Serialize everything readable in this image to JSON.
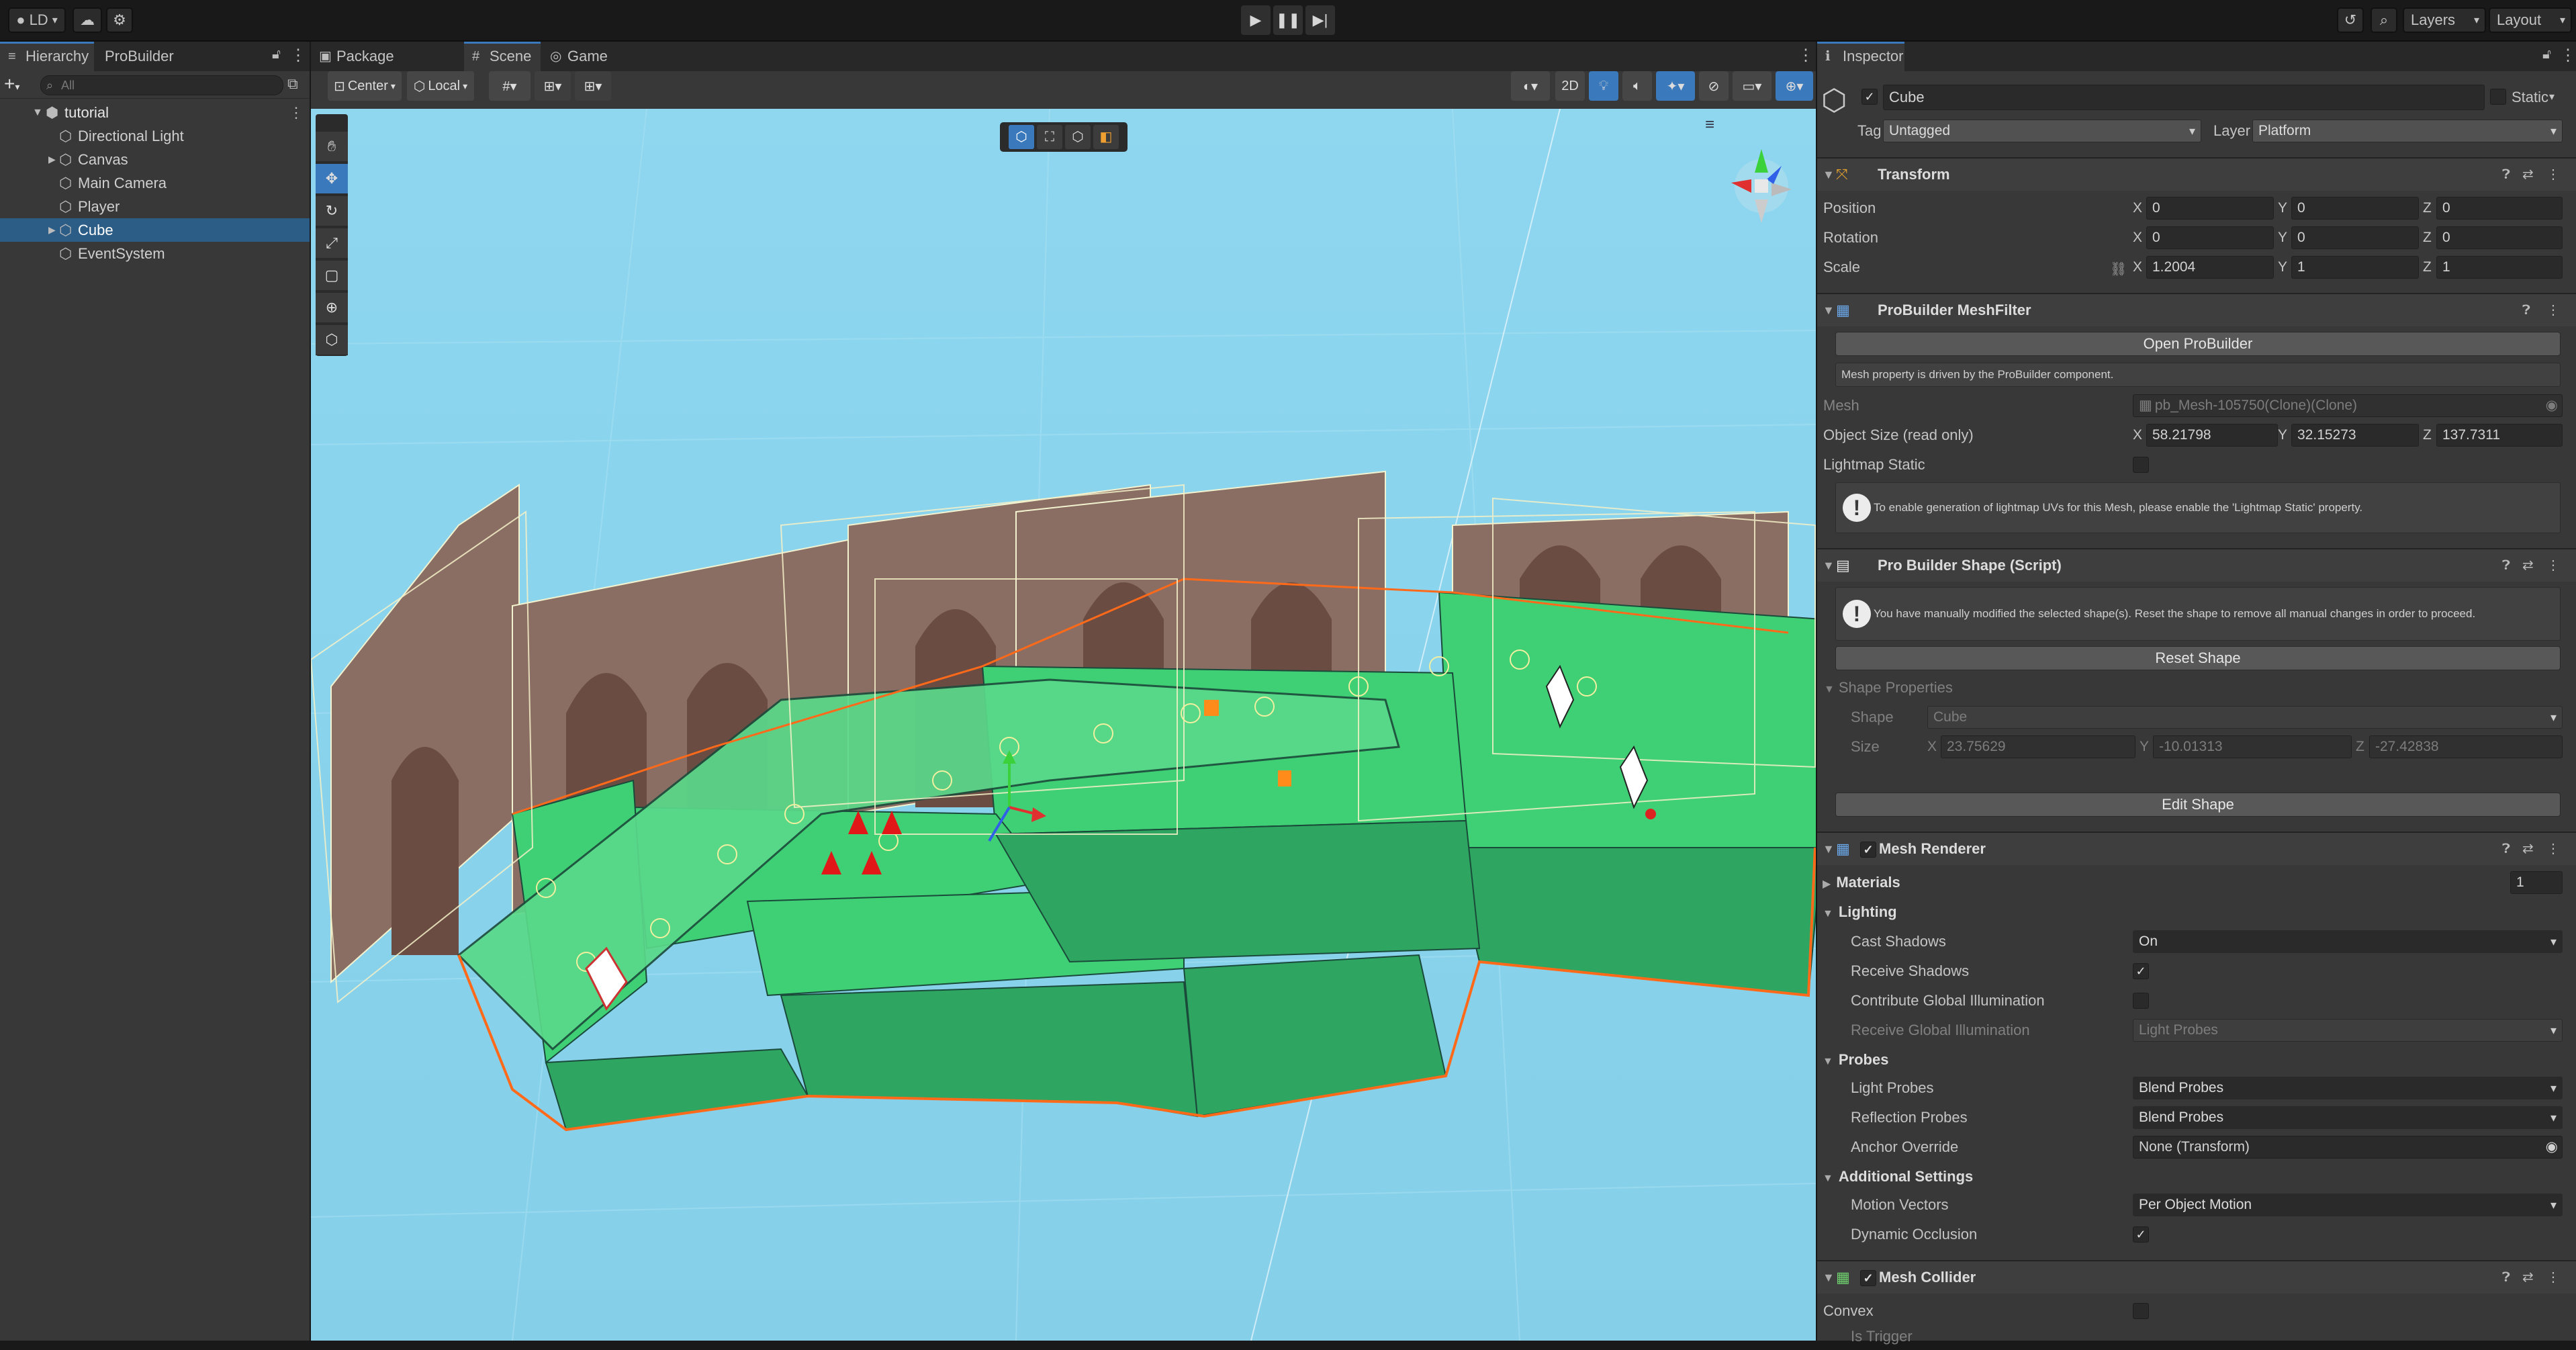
{
  "toolbar": {
    "account": "LD",
    "account_icon": "account-icon",
    "cloud_icon": "cloud-icon",
    "collab_icon": "collab-icon",
    "play_icon": "play-icon",
    "pause_icon": "pause-icon",
    "step_icon": "step-icon",
    "history_icon": "history-icon",
    "search_icon": "search-icon",
    "layers": "Layers",
    "layout": "Layout"
  },
  "hierarchy": {
    "tabs": [
      "Hierarchy",
      "ProBuilder"
    ],
    "add_label": "+",
    "search_placeholder": "All",
    "scene_name": "tutorial",
    "items": [
      {
        "label": "Directional Light",
        "expandable": false,
        "selected": false
      },
      {
        "label": "Canvas",
        "expandable": true,
        "selected": false
      },
      {
        "label": "Main Camera",
        "expandable": false,
        "selected": false
      },
      {
        "label": "Player",
        "expandable": false,
        "selected": false
      },
      {
        "label": "Cube",
        "expandable": true,
        "selected": true
      },
      {
        "label": "EventSystem",
        "expandable": false,
        "selected": false
      }
    ]
  },
  "scene_tabs": [
    "Package Manager",
    "Scene",
    "Game"
  ],
  "scene_toolbar": {
    "pivot": "Center",
    "space": "Local",
    "mode_2d": "2D"
  },
  "inspector": {
    "tab": "Inspector",
    "object_name": "Cube",
    "static_label": "Static",
    "tag_label": "Tag",
    "tag_value": "Untagged",
    "layer_label": "Layer",
    "layer_value": "Platform",
    "transform": {
      "title": "Transform",
      "position_label": "Position",
      "rotation_label": "Rotation",
      "scale_label": "Scale",
      "position": {
        "x": "0",
        "y": "0",
        "z": "0"
      },
      "rotation": {
        "x": "0",
        "y": "0",
        "z": "0"
      },
      "scale": {
        "x": "1.2004",
        "y": "1",
        "z": "1"
      }
    },
    "meshfilter": {
      "title": "ProBuilder MeshFilter",
      "open_button": "Open ProBuilder",
      "driven_note": "Mesh property is driven by the ProBuilder component.",
      "mesh_label": "Mesh",
      "mesh_value": "pb_Mesh-105750(Clone)(Clone)",
      "size_label": "Object Size (read only)",
      "size": {
        "x": "58.21798",
        "y": "32.15273",
        "z": "137.7311"
      },
      "lightmap_label": "Lightmap Static",
      "lightmap_help": "To enable generation of lightmap UVs for this Mesh, please enable the 'Lightmap Static' property."
    },
    "shape": {
      "title": "Pro Builder Shape (Script)",
      "warning": "You have manually modified the selected shape(s). Reset the shape to remove all manual changes in order to proceed.",
      "reset_button": "Reset Shape",
      "props_label": "Shape Properties",
      "shape_label": "Shape",
      "shape_value": "Cube",
      "size_label": "Size",
      "size": {
        "x": "23.75629",
        "y": "-10.01313",
        "z": "-27.42838"
      },
      "edit_button": "Edit Shape"
    },
    "renderer": {
      "title": "Mesh Renderer",
      "materials_label": "Materials",
      "materials_count": "1",
      "lighting_label": "Lighting",
      "cast_shadows_label": "Cast Shadows",
      "cast_shadows_value": "On",
      "receive_shadows_label": "Receive Shadows",
      "contribute_gi_label": "Contribute Global Illumination",
      "receive_gi_label": "Receive Global Illumination",
      "receive_gi_value": "Light Probes",
      "probes_label": "Probes",
      "light_probes_label": "Light Probes",
      "light_probes_value": "Blend Probes",
      "reflection_probes_label": "Reflection Probes",
      "reflection_probes_value": "Blend Probes",
      "anchor_label": "Anchor Override",
      "anchor_value": "None (Transform)",
      "additional_label": "Additional Settings",
      "motion_vectors_label": "Motion Vectors",
      "motion_vectors_value": "Per Object Motion",
      "dynamic_occlusion_label": "Dynamic Occlusion"
    },
    "collider": {
      "title": "Mesh Collider",
      "convex_label": "Convex",
      "trigger_label": "Is Trigger"
    }
  }
}
